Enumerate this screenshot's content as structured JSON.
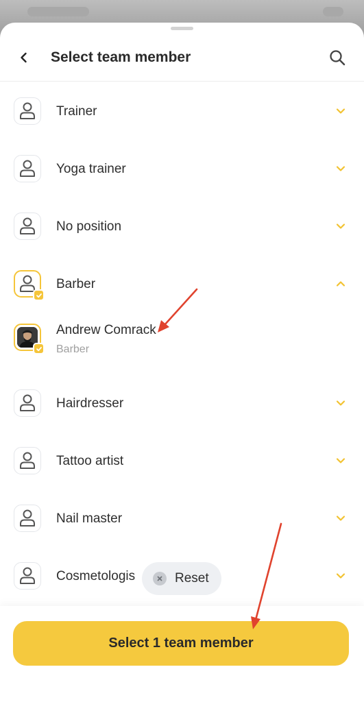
{
  "header": {
    "title": "Select team member",
    "back_icon": "chevron-left-icon",
    "search_icon": "search-icon"
  },
  "groups": [
    {
      "label": "Trainer",
      "expanded": false,
      "selected": false
    },
    {
      "label": "Yoga trainer",
      "expanded": false,
      "selected": false
    },
    {
      "label": "No position",
      "expanded": false,
      "selected": false
    },
    {
      "label": "Barber",
      "expanded": true,
      "selected": true
    },
    {
      "label": "Hairdresser",
      "expanded": false,
      "selected": false
    },
    {
      "label": "Tattoo artist",
      "expanded": false,
      "selected": false
    },
    {
      "label": "Nail master",
      "expanded": false,
      "selected": false
    },
    {
      "label": "Cosmetologis",
      "expanded": false,
      "selected": false
    }
  ],
  "member": {
    "name": "Andrew Comrack",
    "role": "Barber",
    "selected": true
  },
  "reset": {
    "label": "Reset"
  },
  "footer": {
    "cta_label": "Select 1 team member"
  },
  "colors": {
    "accent": "#f5c93e",
    "chevron": "#f2c230",
    "annotation_arrow": "#e0432e"
  }
}
